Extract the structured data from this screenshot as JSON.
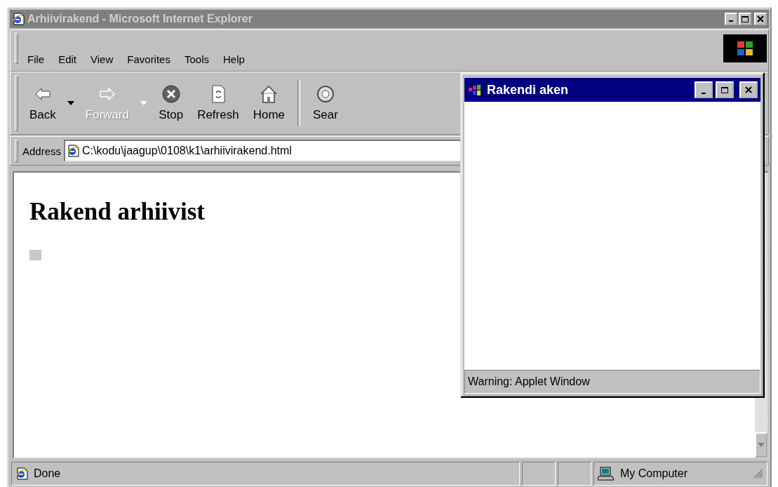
{
  "window": {
    "title": "Arhiivirakend - Microsoft Internet Explorer",
    "active": false
  },
  "menu": [
    {
      "label": "File"
    },
    {
      "label": "Edit"
    },
    {
      "label": "View"
    },
    {
      "label": "Favorites"
    },
    {
      "label": "Tools"
    },
    {
      "label": "Help"
    }
  ],
  "toolbar": [
    {
      "label": "Back",
      "kind": "back",
      "disabled": false,
      "dropdown": true
    },
    {
      "label": "Forward",
      "kind": "forward",
      "disabled": true,
      "dropdown": true
    },
    {
      "label": "Stop",
      "kind": "stop",
      "disabled": false,
      "dropdown": false
    },
    {
      "label": "Refresh",
      "kind": "refresh",
      "disabled": false,
      "dropdown": false
    },
    {
      "label": "Home",
      "kind": "home",
      "disabled": false,
      "dropdown": false
    },
    {
      "label": "Sear",
      "kind": "search",
      "disabled": false,
      "dropdown": false
    }
  ],
  "address": {
    "label": "Address",
    "value": "C:\\kodu\\jaagup\\0108\\k1\\arhiivirakend.html"
  },
  "page": {
    "heading": "Rakend arhiivist"
  },
  "status_bar": {
    "text": "Done",
    "zone": "My Computer"
  },
  "applet_window": {
    "title": "Rakendi aken",
    "active": true,
    "warning": "Warning: Applet Window"
  }
}
